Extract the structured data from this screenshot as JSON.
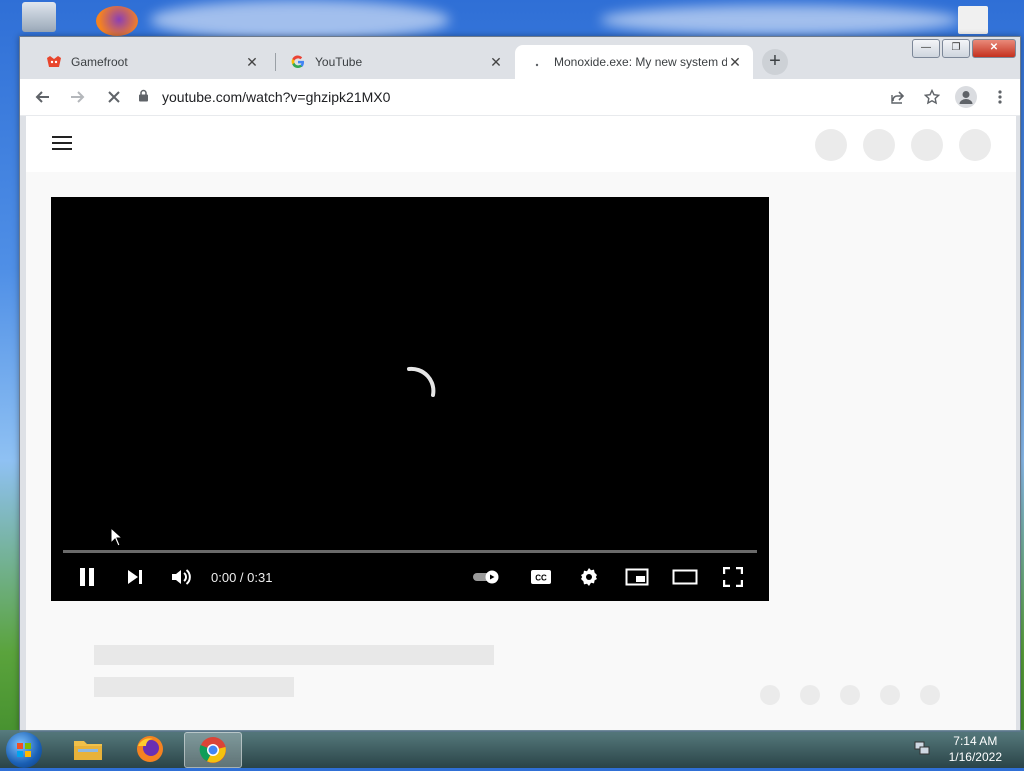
{
  "browser": {
    "tabs": [
      {
        "title": "Gamefroot",
        "favicon": "gamefroot-icon"
      },
      {
        "title": "YouTube",
        "favicon": "google-icon"
      },
      {
        "title": "Monoxide.exe: My new system d",
        "favicon": "loading-icon",
        "active": true
      }
    ],
    "new_tab_label": "+",
    "url": "youtube.com/watch?v=ghzipk21MX0"
  },
  "player": {
    "time": "0:00 / 0:31",
    "progress_fraction": 0.0,
    "state": "loading"
  },
  "taskbar": {
    "clock_time": "7:14 AM",
    "clock_date": "1/16/2022",
    "items": [
      "file-explorer-icon",
      "firefox-icon",
      "chrome-icon"
    ]
  },
  "colors": {
    "page_bg": "#f9f9f9",
    "player_bg": "#000000",
    "skeleton": "#e8e8e8"
  }
}
